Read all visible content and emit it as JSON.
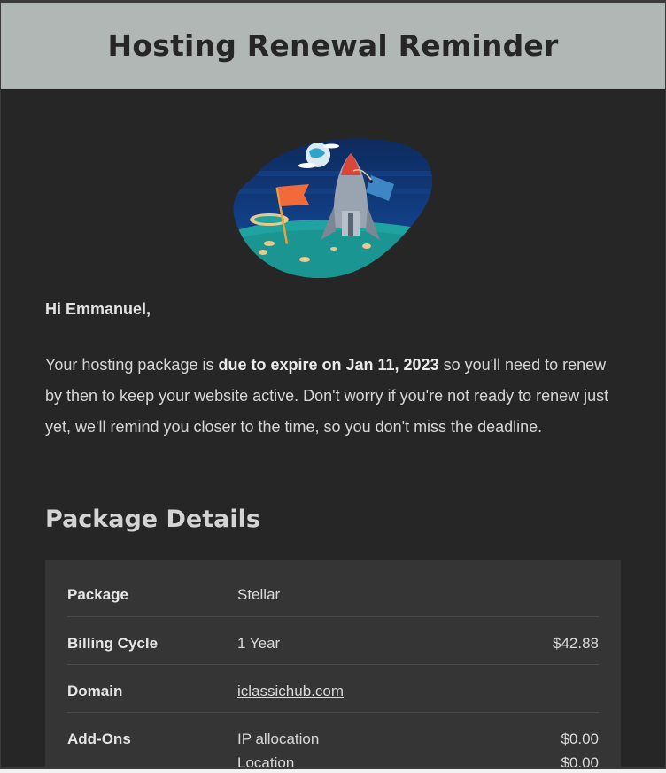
{
  "header": {
    "title": "Hosting Renewal Reminder"
  },
  "hero": {
    "icon": "rocket-on-moon-illustration"
  },
  "body": {
    "greeting": "Hi Emmanuel,",
    "para_prefix": "Your hosting package is ",
    "para_bold": "due to expire on Jan 11, 2023",
    "para_suffix": " so you'll need to renew by then to keep your website active. Don't worry if you're not ready to renew just yet, we'll remind you closer to the time, so you don't miss the deadline."
  },
  "details": {
    "title": "Package Details",
    "package_label": "Package",
    "package_value": "Stellar",
    "billing_label": "Billing Cycle",
    "billing_value": "1 Year",
    "billing_amount": "$42.88",
    "domain_label": "Domain",
    "domain_value": "iclassichub.com",
    "addons_label": "Add-Ons",
    "addons": [
      {
        "name": "IP allocation",
        "amount": "$0.00"
      },
      {
        "name": "Location",
        "amount": "$0.00"
      }
    ]
  },
  "colors": {
    "header_bg": "#b1b7b5",
    "page_bg": "#262626",
    "table_bg": "#353535",
    "flag": "#f26a3a",
    "tag": "#3f86c4"
  }
}
